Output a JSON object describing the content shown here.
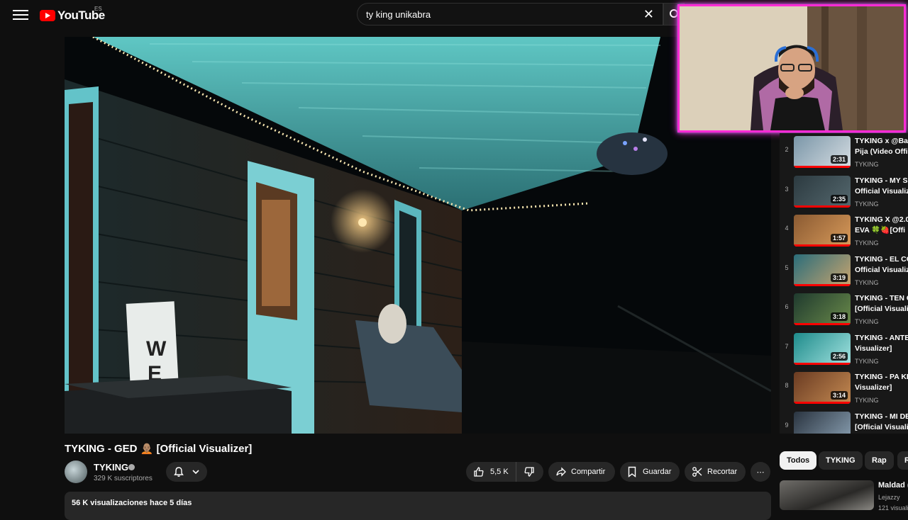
{
  "header": {
    "logo_text": "YouTube",
    "country_code": "ES",
    "search_value": "ty king unikabra",
    "clear_symbol": "✕"
  },
  "player": {
    "sign_text": "W E"
  },
  "video": {
    "title": "TYKING - GED 🧑🏽‍🦲 [Official Visualizer]",
    "channel_name": "TYKING",
    "subscribers": "329 K suscriptores",
    "likes": "5,5 K",
    "share_label": "Compartir",
    "save_label": "Guardar",
    "clip_label": "Recortar",
    "more_symbol": "⋯",
    "views_date": "56 K visualizaciones  hace 5 días"
  },
  "playlist": {
    "items": [
      {
        "index": "2",
        "title_line1": "TYKING x @Bal",
        "title_line2": "Pija (Video Offi",
        "channel": "TYKING",
        "duration": "2:31"
      },
      {
        "index": "3",
        "title_line1": "TYKING - MY S",
        "title_line2": "Official Visualiz",
        "channel": "TYKING",
        "duration": "2:35"
      },
      {
        "index": "4",
        "title_line1": "TYKING X @2.0",
        "title_line2": "EVA 🍀🍓[Offi",
        "channel": "TYKING",
        "duration": "1:57"
      },
      {
        "index": "5",
        "title_line1": "TYKING - EL CO",
        "title_line2": "Official Visualiz",
        "channel": "TYKING",
        "duration": "3:19"
      },
      {
        "index": "6",
        "title_line1": "TYKING - TEN C",
        "title_line2": "[Official Visuali",
        "channel": "TYKING",
        "duration": "3:18"
      },
      {
        "index": "7",
        "title_line1": "TYKING - ANTE",
        "title_line2": "Visualizer]",
        "channel": "TYKING",
        "duration": "2:56"
      },
      {
        "index": "8",
        "title_line1": "TYKING - PA KE",
        "title_line2": "Visualizer]",
        "channel": "TYKING",
        "duration": "3:14"
      },
      {
        "index": "9",
        "title_line1": "TYKING - MI DE",
        "title_line2": "[Official Visuali",
        "channel": "",
        "duration": ""
      }
    ]
  },
  "chips": {
    "all": "Todos",
    "channel": "TYKING",
    "rap": "Rap",
    "more": "R"
  },
  "recommended": {
    "title": "Maldad (",
    "channel": "Lejazzy",
    "views": "121 visualiza"
  },
  "colors": {
    "accent_red": "#ff0000",
    "webcam_border": "#ff2bd6",
    "background": "#0f0f0f"
  }
}
